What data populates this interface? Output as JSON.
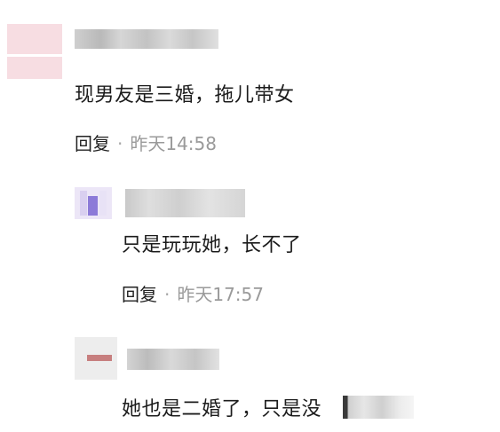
{
  "comments": [
    {
      "text": "现男友是三婚，拖儿带女",
      "reply_label": "回复",
      "separator": "·",
      "timestamp": "昨天14:58"
    },
    {
      "text": "只是玩玩她，长不了",
      "reply_label": "回复",
      "separator": "·",
      "timestamp": "昨天17:57"
    },
    {
      "text": "她也是二婚了，只是没"
    }
  ]
}
